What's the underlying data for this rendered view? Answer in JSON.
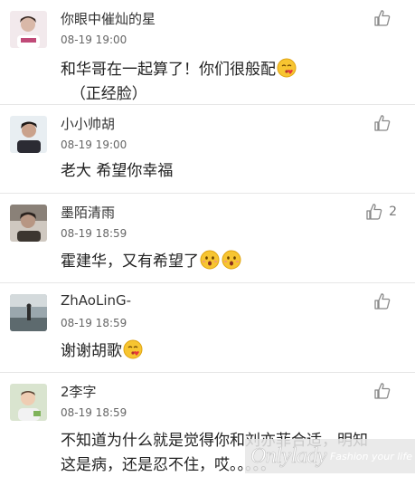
{
  "comments": [
    {
      "name": "你眼中催灿的星",
      "time": "08-19 19:00",
      "text": "和华哥在一起算了！你们很般配",
      "text_after": "（正经脸）",
      "likes": "",
      "emoji": "kiss-emoji"
    },
    {
      "name": "小小帅胡",
      "time": "08-19 19:00",
      "text": "老大 希望你幸福",
      "text_after": "",
      "likes": ""
    },
    {
      "name": "墨陌清雨",
      "time": "08-19 18:59",
      "text": "霍建华，又有希望了",
      "text_after": "",
      "likes": "2",
      "emoji": "surprised-emoji"
    },
    {
      "name": "ZhAoLinG-",
      "time": "08-19 18:59",
      "text": "谢谢胡歌",
      "text_after": "",
      "likes": "",
      "emoji": "kiss-emoji"
    },
    {
      "name": "2李字",
      "time": "08-19 18:59",
      "text": "不知道为什么就是觉得你和刘亦菲合适，明知这是病，还是忍不住，哎。。。。。",
      "text_after": "",
      "likes": ""
    }
  ],
  "watermark": {
    "brand": "Onlylady",
    "tagline": "Fashion your life"
  },
  "colors": {
    "divider": "#e6e6e6",
    "emoji_face": "#f7c531",
    "kiss_heart": "#e8383b"
  }
}
